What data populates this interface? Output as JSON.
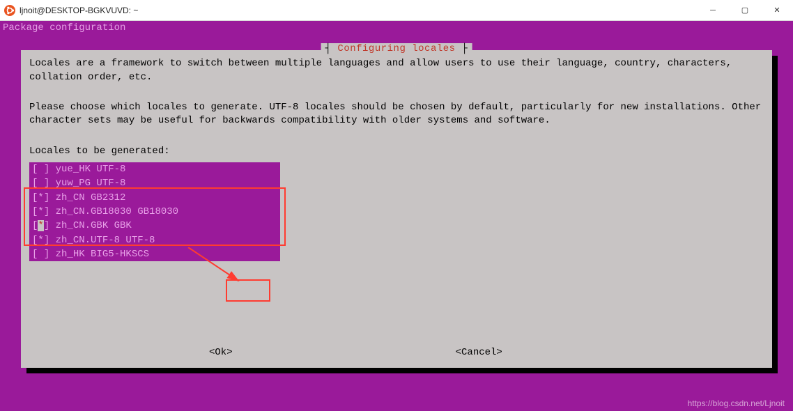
{
  "window": {
    "title": "ljnoit@DESKTOP-BGKVUVD: ~"
  },
  "header": "Package configuration",
  "dialog": {
    "title": "Configuring locales",
    "p1": "Locales are a framework to switch between multiple languages and allow users to use their language, country, characters, collation order, etc.",
    "p2": "Please choose which locales to generate. UTF-8 locales should be chosen by default, particularly for new installations. Other character sets may be useful for backwards compatibility with older systems and software.",
    "prompt": "Locales to be generated:",
    "buttons": {
      "ok": "<Ok>",
      "cancel": "<Cancel>"
    }
  },
  "locales": [
    {
      "checked": false,
      "selected": false,
      "label": "yue_HK UTF-8"
    },
    {
      "checked": false,
      "selected": false,
      "label": "yuw_PG UTF-8"
    },
    {
      "checked": true,
      "selected": false,
      "label": "zh_CN GB2312"
    },
    {
      "checked": true,
      "selected": false,
      "label": "zh_CN.GB18030 GB18030"
    },
    {
      "checked": true,
      "selected": true,
      "label": "zh_CN.GBK GBK"
    },
    {
      "checked": true,
      "selected": false,
      "label": "zh_CN.UTF-8 UTF-8"
    },
    {
      "checked": false,
      "selected": false,
      "label": "zh_HK BIG5-HKSCS"
    }
  ],
  "watermark": "https://blog.csdn.net/Ljnoit"
}
